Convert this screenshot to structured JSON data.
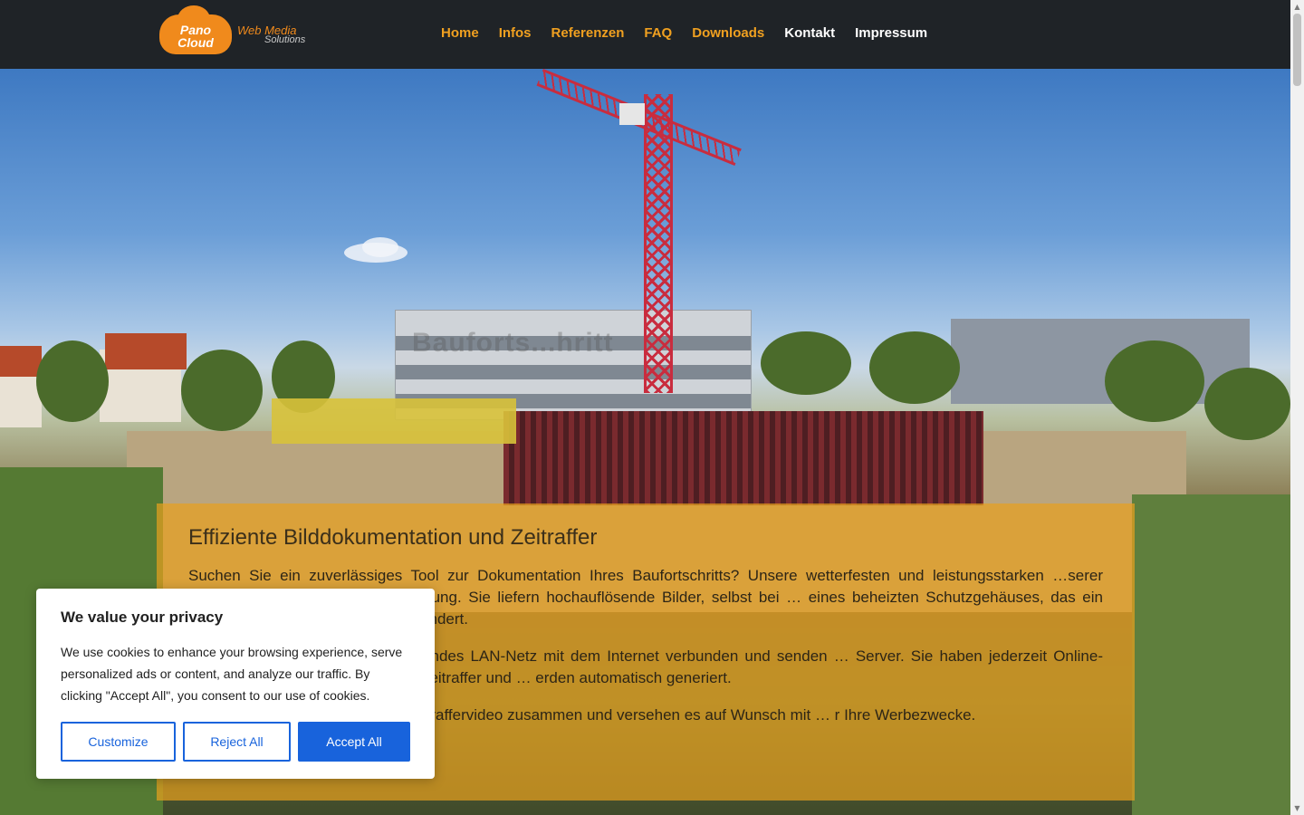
{
  "brand": {
    "logo_line1": "Pano",
    "logo_line2": "Cloud",
    "tagline1": "Web Media",
    "tagline2": "Solutions",
    "accent": "#f08a1c"
  },
  "nav": {
    "items": [
      {
        "label": "Home"
      },
      {
        "label": "Infos"
      },
      {
        "label": "Referenzen"
      },
      {
        "label": "FAQ"
      },
      {
        "label": "Downloads"
      },
      {
        "label": "Kontakt"
      },
      {
        "label": "Impressum"
      }
    ]
  },
  "hero": {
    "ghost_text": "Bauforts...hritt"
  },
  "content": {
    "heading": "Effiziente Bilddokumentation und Zeitraffer",
    "paragraphs": [
      "Suchen Sie ein zuverlässiges Tool zur Dokumentation Ihres Baufortschritts? Unsere wetterfesten und leistungsstarken …serer Panocloud bieten die perfekte Lösung. Sie liefern hochauflösende Bilder, selbst bei … eines beheizten Schutzgehäuses, das ein Einfrieren der Linse im Winter verhindert.",
      "… Mobilfunknetz oder ein bestehendes LAN-Netz mit dem Internet verbunden und senden … Server. Sie haben jederzeit Online-Zugriff auf Ihr Bildarchiv. Tägliche Zeitraffer und … erden automatisch generiert.",
      "… r die Bilder zu einem Gesamtzeitraffervideo zusammen und versehen es auf Wunsch mit … r Ihre Werbezwecke."
    ]
  },
  "cookie": {
    "title": "We value your privacy",
    "text": "We use cookies to enhance your browsing experience, serve personalized ads or content, and analyze our traffic. By clicking \"Accept All\", you consent to our use of cookies.",
    "customize": "Customize",
    "reject": "Reject All",
    "accept": "Accept All",
    "primary_color": "#1863dc"
  },
  "scrollbar": {
    "up": "▲",
    "down": "▼"
  }
}
